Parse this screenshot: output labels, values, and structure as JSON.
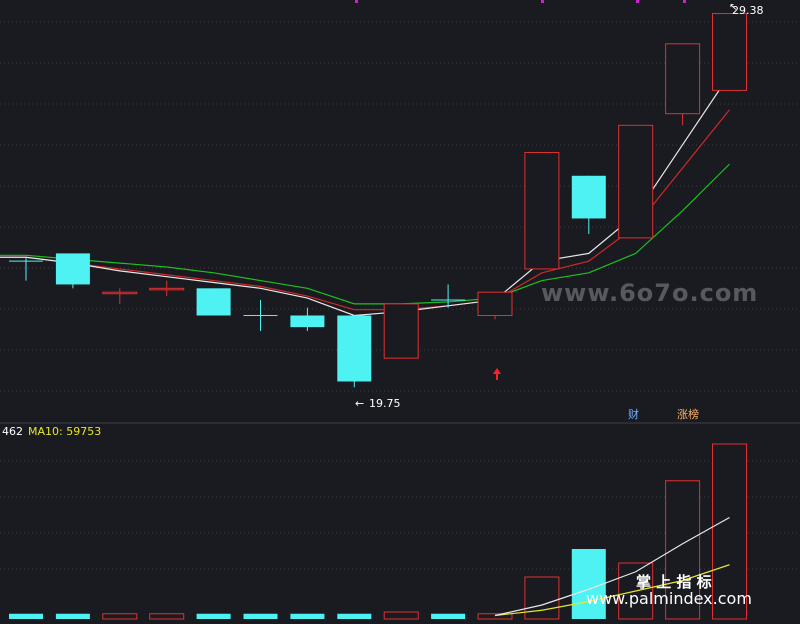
{
  "colors": {
    "background": "#1a1b21",
    "up": "#e03030",
    "down": "#4ff2f2",
    "ma_white": "#e8e8e8",
    "ma_red": "#d02828",
    "ma_green": "#1fbf1f",
    "ma10_label": "#e6e62e",
    "grid": "#3a3a44",
    "marker": "#d020d0"
  },
  "price": {
    "high_label": "29.38",
    "low_label": "19.75",
    "badge_cai": "财",
    "badge_zhangbang": "涨榜"
  },
  "volume": {
    "left_value": "462",
    "ma10_label": "MA10: 59753"
  },
  "watermarks": {
    "top": "www.6o7o.com",
    "cn": "掌 上 指 标",
    "bottom": "www.palmindex.com"
  },
  "chart_data": [
    {
      "type": "candlestick",
      "title": "",
      "candles": [
        {
          "open": 23.0,
          "close": 23.0,
          "high": 23.1,
          "low": 22.5,
          "dir": "flat"
        },
        {
          "open": 23.2,
          "close": 22.4,
          "high": 23.2,
          "low": 22.3,
          "dir": "down"
        },
        {
          "open": 22.2,
          "close": 22.2,
          "high": 22.3,
          "low": 21.9,
          "dir": "up"
        },
        {
          "open": 22.3,
          "close": 22.3,
          "high": 22.5,
          "low": 22.1,
          "dir": "up"
        },
        {
          "open": 22.3,
          "close": 21.6,
          "high": 22.3,
          "low": 21.6,
          "dir": "down"
        },
        {
          "open": 21.6,
          "close": 21.6,
          "high": 22.0,
          "low": 21.2,
          "dir": "flat"
        },
        {
          "open": 21.6,
          "close": 21.3,
          "high": 21.8,
          "low": 21.2,
          "dir": "down"
        },
        {
          "open": 21.6,
          "close": 19.9,
          "high": 21.6,
          "low": 19.75,
          "dir": "down"
        },
        {
          "open": 20.5,
          "close": 21.9,
          "high": 21.9,
          "low": 20.5,
          "dir": "up"
        },
        {
          "open": 22.0,
          "close": 22.0,
          "high": 22.4,
          "low": 21.8,
          "dir": "flat"
        },
        {
          "open": 21.6,
          "close": 22.2,
          "high": 22.2,
          "low": 21.5,
          "dir": "up"
        },
        {
          "open": 22.8,
          "close": 25.8,
          "high": 25.8,
          "low": 22.8,
          "dir": "up"
        },
        {
          "open": 25.2,
          "close": 24.1,
          "high": 25.2,
          "low": 23.7,
          "dir": "down"
        },
        {
          "open": 23.6,
          "close": 26.5,
          "high": 26.5,
          "low": 23.6,
          "dir": "up"
        },
        {
          "open": 26.8,
          "close": 28.6,
          "high": 28.6,
          "low": 26.5,
          "dir": "up"
        },
        {
          "open": 27.4,
          "close": 29.38,
          "high": 29.38,
          "low": 27.4,
          "dir": "up"
        }
      ],
      "ma_white": [
        23.1,
        22.95,
        22.75,
        22.6,
        22.45,
        22.3,
        22.05,
        21.6,
        21.7,
        21.85,
        22.0,
        23.0,
        23.2,
        24.2,
        26.0,
        27.8
      ],
      "ma_red": [
        23.1,
        22.95,
        22.8,
        22.65,
        22.5,
        22.35,
        22.1,
        21.75,
        21.75,
        21.85,
        22.0,
        22.7,
        23.0,
        23.9,
        25.4,
        26.9
      ],
      "ma_green": [
        23.15,
        23.05,
        22.95,
        22.85,
        22.7,
        22.5,
        22.3,
        21.9,
        21.9,
        21.95,
        22.05,
        22.5,
        22.7,
        23.2,
        24.3,
        25.5
      ],
      "ylim": [
        19.5,
        29.6
      ]
    },
    {
      "type": "bar",
      "title": "",
      "values": [
        3,
        3,
        3,
        3,
        3,
        3,
        3,
        3,
        4,
        3,
        3,
        24,
        40,
        32,
        79,
        100
      ],
      "ma_white": [
        null,
        null,
        null,
        null,
        null,
        null,
        null,
        null,
        null,
        null,
        2,
        8,
        17,
        27,
        43,
        58
      ],
      "ma_yellow": [
        null,
        null,
        null,
        null,
        null,
        null,
        null,
        null,
        null,
        null,
        2,
        5,
        10,
        16,
        22,
        31
      ],
      "ylim": [
        0,
        100
      ]
    }
  ]
}
